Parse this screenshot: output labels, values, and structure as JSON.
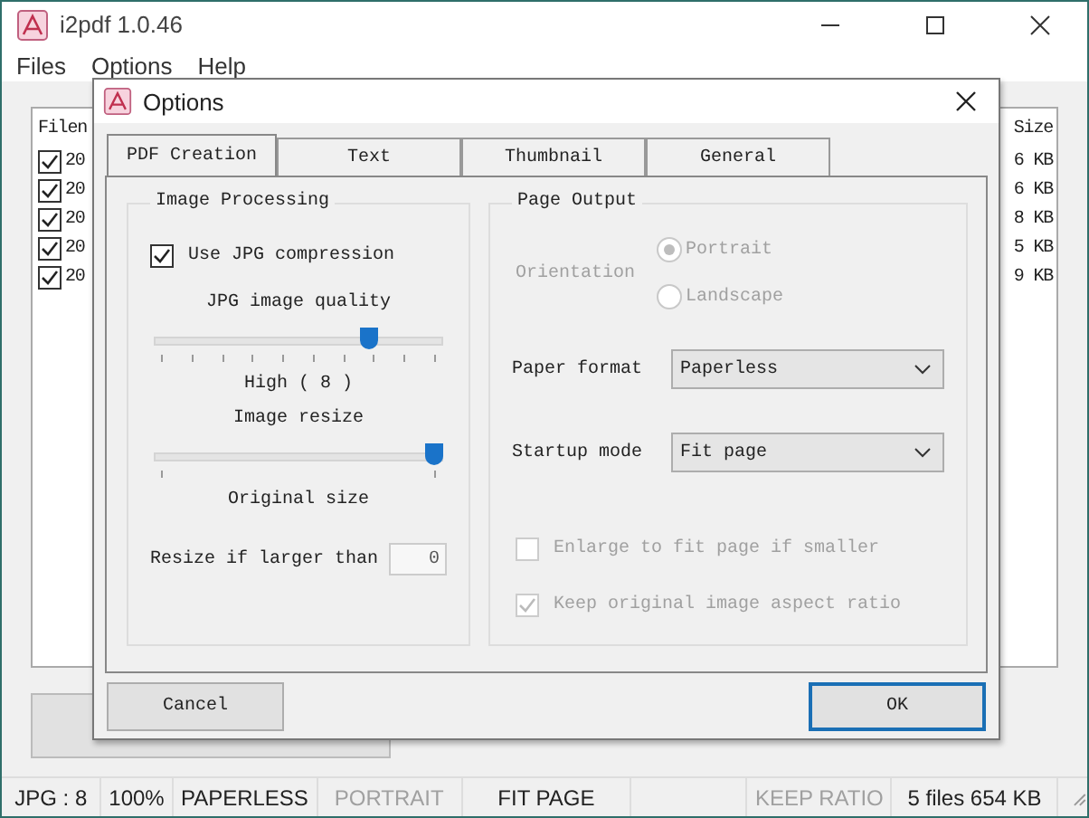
{
  "window": {
    "title": "i2pdf 1.0.46"
  },
  "menu": [
    "Files",
    "Options",
    "Help"
  ],
  "file_list": {
    "columns": [
      "Filen",
      "Size"
    ],
    "rows": [
      {
        "name": "20",
        "size": "6 KB",
        "checked": true
      },
      {
        "name": "20",
        "size": "6 KB",
        "checked": true
      },
      {
        "name": "20",
        "size": "8 KB",
        "checked": true
      },
      {
        "name": "20",
        "size": "5 KB",
        "checked": true
      },
      {
        "name": "20",
        "size": "9 KB",
        "checked": true
      }
    ]
  },
  "dialog": {
    "title": "Options",
    "tabs": [
      {
        "label": "PDF Creation",
        "selected": true
      },
      {
        "label": "Text",
        "selected": false
      },
      {
        "label": "Thumbnail",
        "selected": false
      },
      {
        "label": "General",
        "selected": false
      }
    ],
    "image_processing": {
      "title": "Image Processing",
      "jpg_compression": {
        "label": "Use JPG compression",
        "checked": true
      },
      "quality_label": "JPG image quality",
      "quality": {
        "level": 0.76
      },
      "quality_reading": "High ( 8 )",
      "resize_label": "Image resize",
      "resize": {
        "level": 1
      },
      "resize_reading": "Original size",
      "resize_if_larger": {
        "label": "Resize if larger than",
        "value": "0"
      }
    },
    "page_output": {
      "title": "Page Output",
      "orientation_label": "Orientation",
      "orientation": [
        {
          "label": "Portrait",
          "selected": true
        },
        {
          "label": "Landscape",
          "selected": false
        }
      ],
      "paper_format": {
        "label": "Paper format",
        "value": "Paperless"
      },
      "startup_mode": {
        "label": "Startup mode",
        "value": "Fit page"
      },
      "options": [
        {
          "label": "Enlarge to fit page if smaller",
          "checked": false,
          "disabled": true
        },
        {
          "label": "Keep original image aspect ratio",
          "checked": true,
          "disabled": true
        }
      ]
    },
    "buttons": [
      {
        "label": "Cancel",
        "default": false
      },
      {
        "label": "OK",
        "default": true
      }
    ]
  },
  "status_bar": [
    {
      "text": "JPG : 8",
      "disabled": false
    },
    {
      "text": "100%",
      "disabled": false
    },
    {
      "text": "PAPERLESS",
      "disabled": false
    },
    {
      "text": "PORTRAIT",
      "disabled": true
    },
    {
      "text": "FIT PAGE",
      "disabled": false
    },
    {
      "text": "KEEP RATIO",
      "disabled": true
    },
    {
      "text": "5 files  654 KB",
      "disabled": false
    }
  ]
}
